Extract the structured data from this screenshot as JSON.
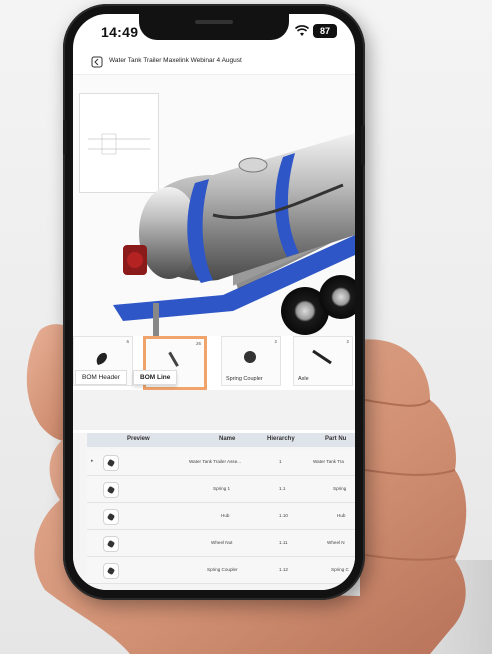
{
  "status_bar": {
    "time": "14:49",
    "battery": "87"
  },
  "title_bar": {
    "document_title": "Water Tank Trailer Maxelink Webinar 4 August"
  },
  "viewer": {
    "model_name": "water-tank-trailer"
  },
  "bom_strip": {
    "cards": [
      {
        "num": "6",
        "label": "BOM Header",
        "active": false
      },
      {
        "num": "26",
        "label": "BOM Line",
        "active": true
      },
      {
        "num": "2",
        "label": "Spring Coupler",
        "active": false
      },
      {
        "num": "2",
        "label": "Axle",
        "active": false
      }
    ]
  },
  "table": {
    "headers": [
      "Preview",
      "Name",
      "Hierarchy",
      "Part Nu"
    ],
    "rows": [
      {
        "name": "Water Tank Trailer Asse...",
        "hierarchy": "1",
        "part": "Water Tank Tra"
      },
      {
        "name": "Spring 1",
        "hierarchy": "1.1",
        "part": "Spring"
      },
      {
        "name": "Hub",
        "hierarchy": "1.10",
        "part": "Hub"
      },
      {
        "name": "Wheel Nut",
        "hierarchy": "1.11",
        "part": "Wheel N"
      },
      {
        "name": "Spring Coupler",
        "hierarchy": "1.12",
        "part": "Spring C"
      }
    ]
  },
  "colors": {
    "frame_blue": "#2f56c6",
    "tank_silver": "#c9c9c9",
    "accent_orange": "#f0a46b",
    "skin": "#d99a7e"
  }
}
